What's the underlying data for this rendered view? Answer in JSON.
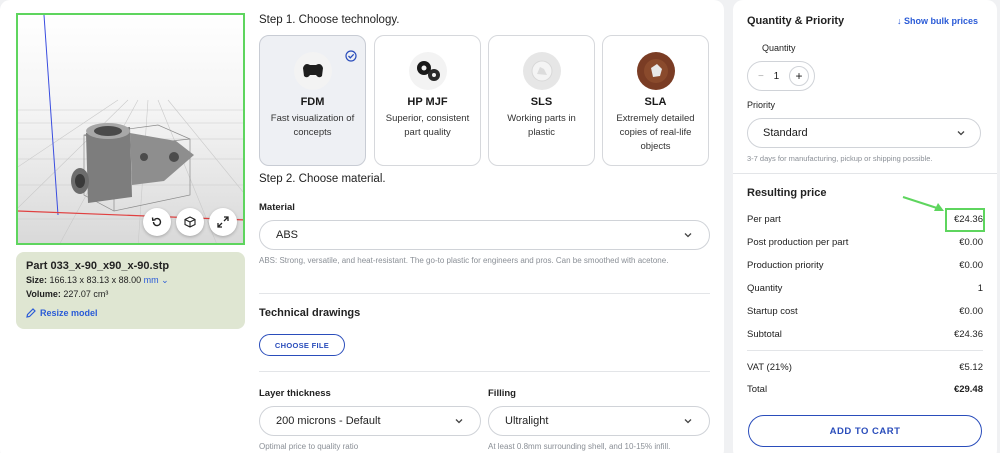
{
  "viewer": {
    "part_name": "Part 033_x-90_x90_x-90.stp",
    "size_label": "Size:",
    "size_value": "166.13 x 83.13 x 88.00",
    "size_unit": "mm",
    "volume_label": "Volume:",
    "volume_value": "227.07 cm³",
    "resize_label": "Resize model",
    "buttons": [
      "reset-view-icon",
      "cube-view-icon",
      "fullscreen-icon"
    ]
  },
  "step1": {
    "title": "Step 1. Choose technology.",
    "cards": [
      {
        "name": "FDM",
        "desc": "Fast visualization of concepts",
        "selected": true
      },
      {
        "name": "HP MJF",
        "desc": "Superior, consistent part quality",
        "selected": false
      },
      {
        "name": "SLS",
        "desc": "Working parts in plastic",
        "selected": false
      },
      {
        "name": "SLA",
        "desc": "Extremely detailed copies of real-life objects",
        "selected": false
      }
    ]
  },
  "step2": {
    "title": "Step 2. Choose material.",
    "material_label": "Material",
    "material_value": "ABS",
    "material_hint": "ABS: Strong, versatile, and heat-resistant. The go-to plastic for engineers and pros. Can be smoothed with acetone."
  },
  "drawings": {
    "title": "Technical drawings",
    "button": "CHOOSE FILE"
  },
  "layer": {
    "label": "Layer thickness",
    "value": "200 microns - Default",
    "hint": "Optimal price to quality ratio"
  },
  "filling": {
    "label": "Filling",
    "value": "Ultralight",
    "hint": "At least 0.8mm surrounding shell, and 10-15% infill."
  },
  "quantity": {
    "title": "Quantity & Priority",
    "bulk_link": "Show bulk prices",
    "qty_label": "Quantity",
    "minus": "−",
    "qty_value": "1",
    "plus": "+",
    "priority_label": "Priority",
    "priority_value": "Standard",
    "priority_hint": "3-7 days for manufacturing, pickup or shipping possible."
  },
  "price": {
    "title": "Resulting price",
    "rows": [
      {
        "label": "Per part",
        "value": "€24.36"
      },
      {
        "label": "Post production per part",
        "value": "€0.00"
      },
      {
        "label": "Production priority",
        "value": "€0.00"
      },
      {
        "label": "Quantity",
        "value": "1"
      },
      {
        "label": "Startup cost",
        "value": "€0.00"
      },
      {
        "label": "Subtotal",
        "value": "€24.36"
      }
    ],
    "vat_label": "VAT (21%)",
    "vat_value": "€5.12",
    "total_label": "Total",
    "total_value": "€29.48",
    "cart_button": "ADD TO CART"
  },
  "colors": {
    "accent": "#2a4dbb",
    "highlight": "#5ed55e",
    "info_bg": "#dfe6d2"
  }
}
